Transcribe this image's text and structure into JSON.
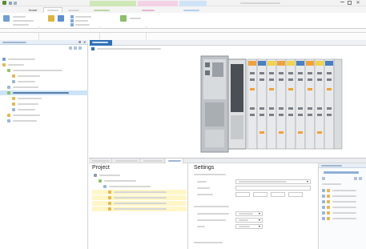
{
  "app": {
    "title": "",
    "tabs": [
      {
        "label": ""
      },
      {
        "label": "Home"
      },
      {
        "label": ""
      },
      {
        "label": ""
      },
      {
        "label": ""
      },
      {
        "label": ""
      },
      {
        "label": ""
      }
    ],
    "ribbon_groups": [
      {
        "label": ""
      },
      {
        "label": ""
      },
      {
        "label": ""
      },
      {
        "label": ""
      },
      {
        "label": ""
      }
    ]
  },
  "project_tree": {
    "title": "",
    "items": [
      {
        "label": ""
      },
      {
        "label": ""
      },
      {
        "label": ""
      },
      {
        "label": ""
      },
      {
        "label": ""
      },
      {
        "label": ""
      },
      {
        "label": ""
      },
      {
        "label": ""
      },
      {
        "label": ""
      },
      {
        "label": ""
      },
      {
        "label": ""
      },
      {
        "label": ""
      }
    ]
  },
  "document": {
    "tab_label": "",
    "path": ""
  },
  "bottom_tabs": [
    {
      "label": ""
    },
    {
      "label": ""
    },
    {
      "label": ""
    },
    {
      "label": ""
    }
  ],
  "project_panel": {
    "title": "Project",
    "items": [
      {
        "label": ""
      },
      {
        "label": ""
      },
      {
        "label": ""
      },
      {
        "label": ""
      },
      {
        "label": ""
      },
      {
        "label": ""
      },
      {
        "label": ""
      }
    ]
  },
  "settings_panel": {
    "title": "Settings",
    "sections": [
      {
        "label": ""
      },
      {
        "label": ""
      },
      {
        "label": ""
      }
    ],
    "rows": [
      {
        "label": "",
        "value": ""
      },
      {
        "label": "",
        "value": ""
      },
      {
        "label": "",
        "value": ""
      },
      {
        "label": "",
        "value": ""
      },
      {
        "label": "",
        "value": ""
      },
      {
        "label": "",
        "value": ""
      }
    ]
  },
  "right_panel": {
    "title": "",
    "items": [
      {
        "label": ""
      },
      {
        "label": ""
      },
      {
        "label": ""
      },
      {
        "label": ""
      },
      {
        "label": ""
      },
      {
        "label": ""
      }
    ]
  },
  "colors": {
    "accent": "#2f71b8",
    "selection": "#cde4f7",
    "ribbon_context_green": "#cfe8b8",
    "ribbon_context_pink": "#f3d2e6",
    "ribbon_context_blue": "#cfe3f7",
    "module_orange": "#f0a23a",
    "module_yellow": "#f2d34a",
    "module_blue": "#4a7fc1"
  }
}
